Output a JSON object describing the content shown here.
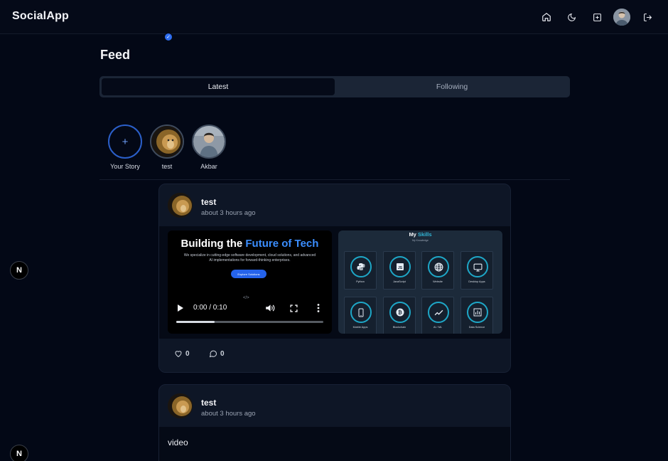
{
  "app": {
    "brand": "SocialApp"
  },
  "nav": {
    "icons": [
      "home-icon",
      "moon-icon",
      "plus-square-icon",
      "user-avatar",
      "logout-icon"
    ]
  },
  "feed": {
    "title": "Feed",
    "tabs": [
      {
        "label": "Latest",
        "active": true
      },
      {
        "label": "Following",
        "active": false
      }
    ]
  },
  "stories": [
    {
      "label": "Your Story",
      "icon": "plus-icon"
    },
    {
      "label": "test"
    },
    {
      "label": "Akbar"
    }
  ],
  "posts": [
    {
      "author": "test",
      "time": "about 3 hours ago",
      "video": {
        "headline_lead": "Building the ",
        "headline_accent": "Future of Tech",
        "subtext": "We specialize in cutting-edge software development, cloud solutions, and advanced AI implementations for forward-thinking enterprises.",
        "button": "Explore Solutions",
        "code_glyph": "</>",
        "time": "0:00 / 0:10",
        "progress": 0.26
      },
      "skills_image": {
        "title_lead": "My ",
        "title_accent": "Skills",
        "subtitle": "My Knowledge",
        "items": [
          "Python",
          "JavaScript",
          "Website",
          "Desktop Apps",
          "Mobile Apps",
          "Blockchain",
          "AI / ML",
          "Data Science"
        ]
      },
      "likes": "0",
      "comments": "0"
    },
    {
      "author": "test",
      "time": "about 3 hours ago",
      "text": "video"
    }
  ],
  "dev_badge": "N",
  "colors": {
    "background": "#030816",
    "card": "#0e1626",
    "accent": "#3b8eff",
    "skill_ring": "#1ea7c7"
  }
}
